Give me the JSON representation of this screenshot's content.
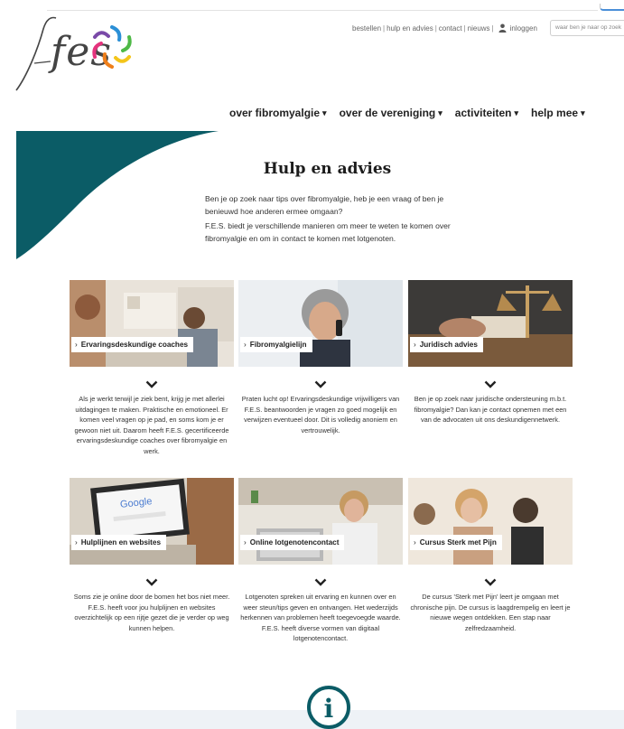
{
  "brand": {
    "logo_text": "fes",
    "colors": {
      "teal": "#0b5c66",
      "logo_pink": "#e5337d",
      "logo_blue": "#2b8fd6",
      "logo_green": "#4eb947",
      "logo_yellow": "#f4c51a",
      "logo_purple": "#7a4aa8",
      "logo_orange": "#ef7f1a"
    }
  },
  "utility_nav": {
    "items": [
      "bestellen",
      "hulp en advies",
      "contact",
      "nieuws"
    ],
    "login_label": "inloggen",
    "search_placeholder": "waar ben je naar op zoek"
  },
  "main_nav": {
    "items": [
      {
        "label": "over fibromyalgie"
      },
      {
        "label": "over de vereniging"
      },
      {
        "label": "activiteiten"
      },
      {
        "label": "help mee"
      }
    ],
    "caret": "▾"
  },
  "page": {
    "title": "Hulp en advies",
    "intro_1": "Ben je op zoek naar tips over fibromyalgie, heb je een vraag of ben je benieuwd hoe anderen ermee omgaan?",
    "intro_2": "F.E.S. biedt je verschillende manieren om meer te weten te komen over fibromyalgie en om in contact te komen met lotgenoten."
  },
  "cards": [
    {
      "title": "Ervaringsdeskundige coaches",
      "text": "Als je werkt terwijl je ziek bent, krijg je met allerlei uitdagingen te maken. Praktische en emotioneel. Er komen veel vragen op je pad, en soms kom je er gewoon niet uit. Daarom heeft F.E.S. gecertificeerde ervaringsdeskundige coaches over fibromyalgie en werk."
    },
    {
      "title": "Fibromyalgielijn",
      "text": "Praten lucht op! Ervaringsdeskundige vrijwilligers van F.E.S. beantwoorden je vragen zo goed mogelijk en verwijzen eventueel door.  Dit is volledig anoniem en vertrouwelijk."
    },
    {
      "title": "Juridisch advies",
      "text": "Ben je op zoek naar juridische ondersteuning m.b.t. fibromyalgie? Dan kan je contact opnemen met een van de advocaten uit ons deskundigennetwerk."
    },
    {
      "title": "Hulplijnen en websites",
      "text": "Soms zie je online door de bomen het bos niet meer. F.E.S. heeft voor jou hulplijnen en websites overzichtelijk op een rijtje gezet die je verder op weg kunnen helpen.",
      "screen_text": "Google"
    },
    {
      "title": "Online lotgenotencontact",
      "text": "Lotgenoten spreken uit ervaring en kunnen over en weer steun/tips geven en ontvangen. Het wederzijds herkennen van problemen heeft toegevoegde waarde. F.E.S. heeft diverse vormen van digitaal lotgenotencontact."
    },
    {
      "title": "Cursus Sterk met Pijn",
      "text": "De cursus 'Sterk met Pijn' leert je omgaan met chronische pijn. De cursus is laagdrempelig en leert je nieuwe wegen ontdekken. Een stap naar zelfredzaamheid."
    }
  ],
  "info_badge": {
    "glyph": "i"
  }
}
